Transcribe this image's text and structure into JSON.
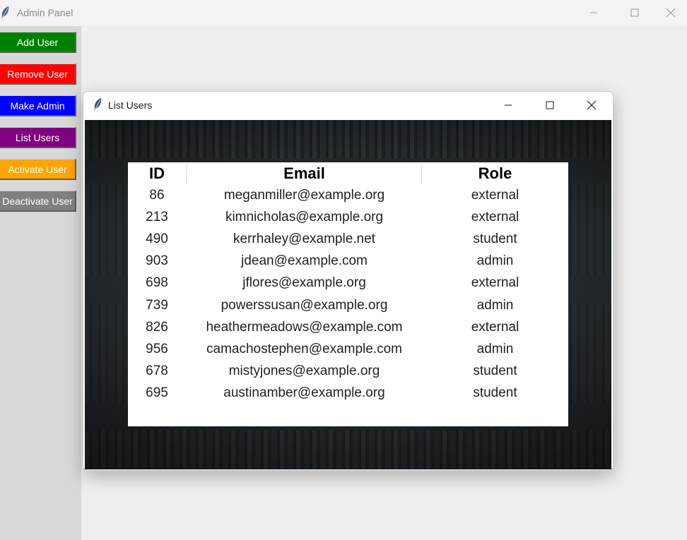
{
  "app": {
    "title": "Admin Panel",
    "icon": "feather-icon"
  },
  "sidebar": {
    "buttons": [
      {
        "label": "Add User",
        "color": "#008000"
      },
      {
        "label": "Remove User",
        "color": "#ff0000"
      },
      {
        "label": "Make Admin",
        "color": "#0000ff"
      },
      {
        "label": "List Users",
        "color": "#800080"
      },
      {
        "label": "Activate User",
        "color": "#ffa500"
      },
      {
        "label": "Deactivate User",
        "color": "#808080"
      }
    ]
  },
  "dialog": {
    "title": "List Users",
    "icon": "feather-icon",
    "table": {
      "headers": [
        "ID",
        "Email",
        "Role"
      ],
      "rows": [
        [
          "86",
          "meganmiller@example.org",
          "external"
        ],
        [
          "213",
          "kimnicholas@example.org",
          "external"
        ],
        [
          "490",
          "kerrhaley@example.net",
          "student"
        ],
        [
          "903",
          "jdean@example.com",
          "admin"
        ],
        [
          "698",
          "jflores@example.org",
          "external"
        ],
        [
          "739",
          "powerssusan@example.org",
          "admin"
        ],
        [
          "826",
          "heathermeadows@example.com",
          "external"
        ],
        [
          "956",
          "camachostephen@example.com",
          "admin"
        ],
        [
          "678",
          "mistyjones@example.org",
          "student"
        ],
        [
          "695",
          "austinamber@example.org",
          "student"
        ]
      ]
    }
  }
}
